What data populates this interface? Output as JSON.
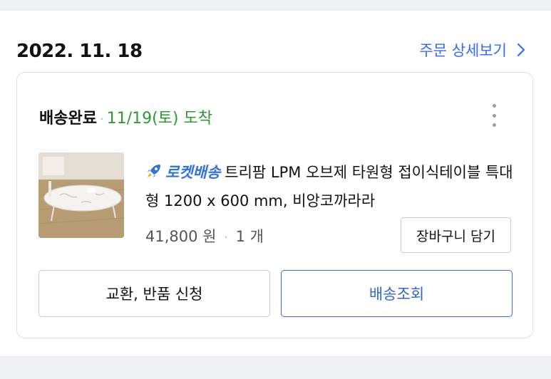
{
  "order": {
    "date": "2022. 11. 18",
    "detail_link_label": "주문 상세보기"
  },
  "shipment": {
    "status": "배송완료",
    "separator": "·",
    "arrival": "11/19(토) 도착"
  },
  "product": {
    "rocket_label": "로켓배송",
    "title": "트리팜 LPM 오브제 타원형 접이식테이블 특대형 1200 x 600 mm, 비앙코까라라",
    "price": "41,800 원",
    "quantity": "1 개"
  },
  "actions": {
    "cart_label": "장바구니 담기",
    "exchange_label": "교환, 반품 신청",
    "track_label": "배송조회"
  },
  "colors": {
    "link_blue": "#346aff",
    "arrival_green": "#2e9a2e",
    "rocket_blue": "#2f73e0",
    "track_border": "#3d6fd9"
  },
  "icons": {
    "detail_link": "chevron-right-icon",
    "more": "more-vertical-icon",
    "rocket": "rocket-icon"
  }
}
